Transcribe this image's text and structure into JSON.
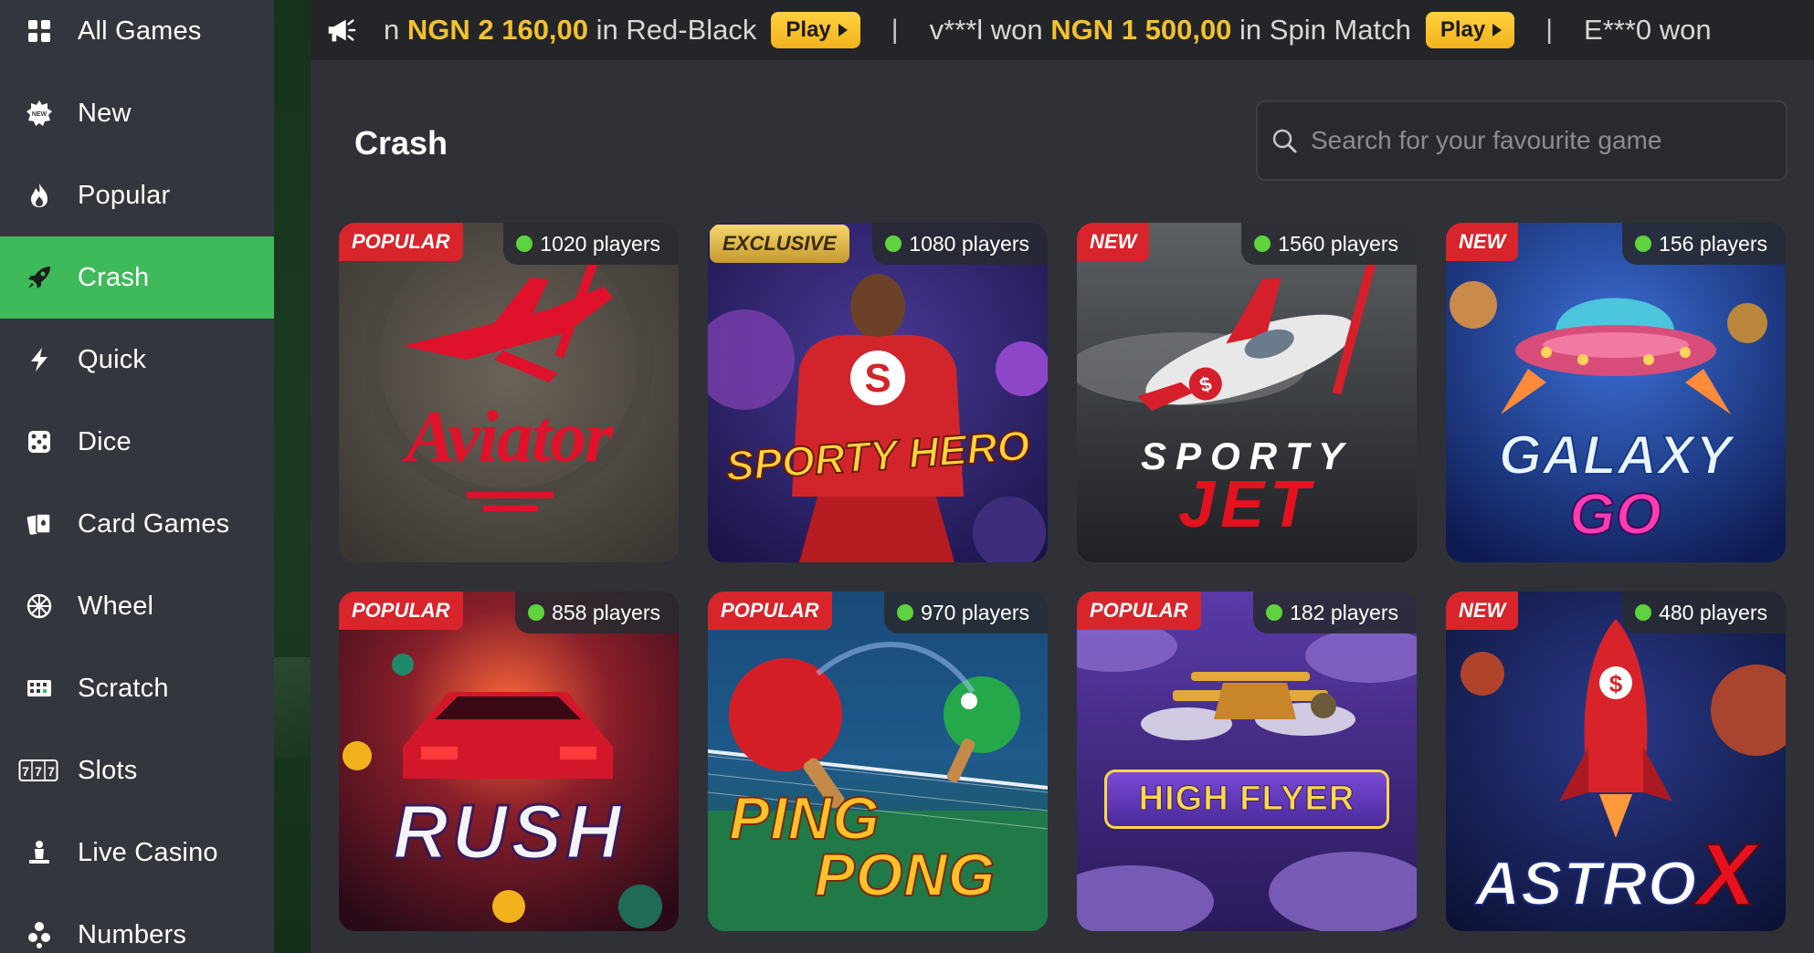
{
  "sidebar": {
    "items": [
      {
        "label": "All Games",
        "icon": "grid-icon"
      },
      {
        "label": "New",
        "icon": "new-burst-icon"
      },
      {
        "label": "Popular",
        "icon": "flame-icon"
      },
      {
        "label": "Crash",
        "icon": "rocket-icon",
        "active": true
      },
      {
        "label": "Quick",
        "icon": "lightning-icon"
      },
      {
        "label": "Dice",
        "icon": "dice-icon"
      },
      {
        "label": "Card Games",
        "icon": "cards-icon"
      },
      {
        "label": "Wheel",
        "icon": "wheel-icon"
      },
      {
        "label": "Scratch",
        "icon": "scratch-icon"
      },
      {
        "label": "Slots",
        "icon": "slots-777-icon"
      },
      {
        "label": "Live Casino",
        "icon": "live-dealer-icon"
      },
      {
        "label": "Numbers",
        "icon": "numbers-balls-icon"
      }
    ],
    "active_color": "#3fba5a"
  },
  "ticker": {
    "entries": [
      {
        "prefix": "n ",
        "amount": "NGN 2 160,00",
        "suffix": " in Red-Black",
        "button": "Play"
      },
      {
        "prefix": "v***l won ",
        "amount": "NGN 1 500,00",
        "suffix": " in Spin Match",
        "button": "Play"
      },
      {
        "prefix": "E***0 won",
        "amount": "",
        "suffix": "",
        "button": ""
      }
    ],
    "separator": "|",
    "accent_color": "#f2c12e"
  },
  "page": {
    "title": "Crash",
    "search_placeholder": "Search for your favourite game"
  },
  "games": [
    {
      "title": "Aviator",
      "badge": "POPULAR",
      "players": "1020 players"
    },
    {
      "title": "SPORTY HERO",
      "badge": "EXCLUSIVE",
      "players": "1080 players"
    },
    {
      "title": "SPORTY JET",
      "title_line1": "SPORTY",
      "title_line2": "JET",
      "badge": "NEW",
      "players": "1560 players"
    },
    {
      "title": "GALAXY GO",
      "title_line1": "GALAXY",
      "title_line2": "GO",
      "badge": "NEW",
      "players": "156 players"
    },
    {
      "title": "RUSH",
      "badge": "POPULAR",
      "players": "858 players"
    },
    {
      "title": "PING PONG",
      "title_line1": "PING",
      "title_line2": "PONG",
      "badge": "POPULAR",
      "players": "970 players"
    },
    {
      "title": "HIGH FLYER",
      "badge": "POPULAR",
      "players": "182 players"
    },
    {
      "title": "ASTRO X",
      "title_line1": "ASTRO",
      "title_line2": "X",
      "badge": "NEW",
      "players": "480 players"
    }
  ],
  "colors": {
    "badge_red": "#d8242b",
    "player_dot": "#5ed33d",
    "play_button": "#f2b21c"
  }
}
